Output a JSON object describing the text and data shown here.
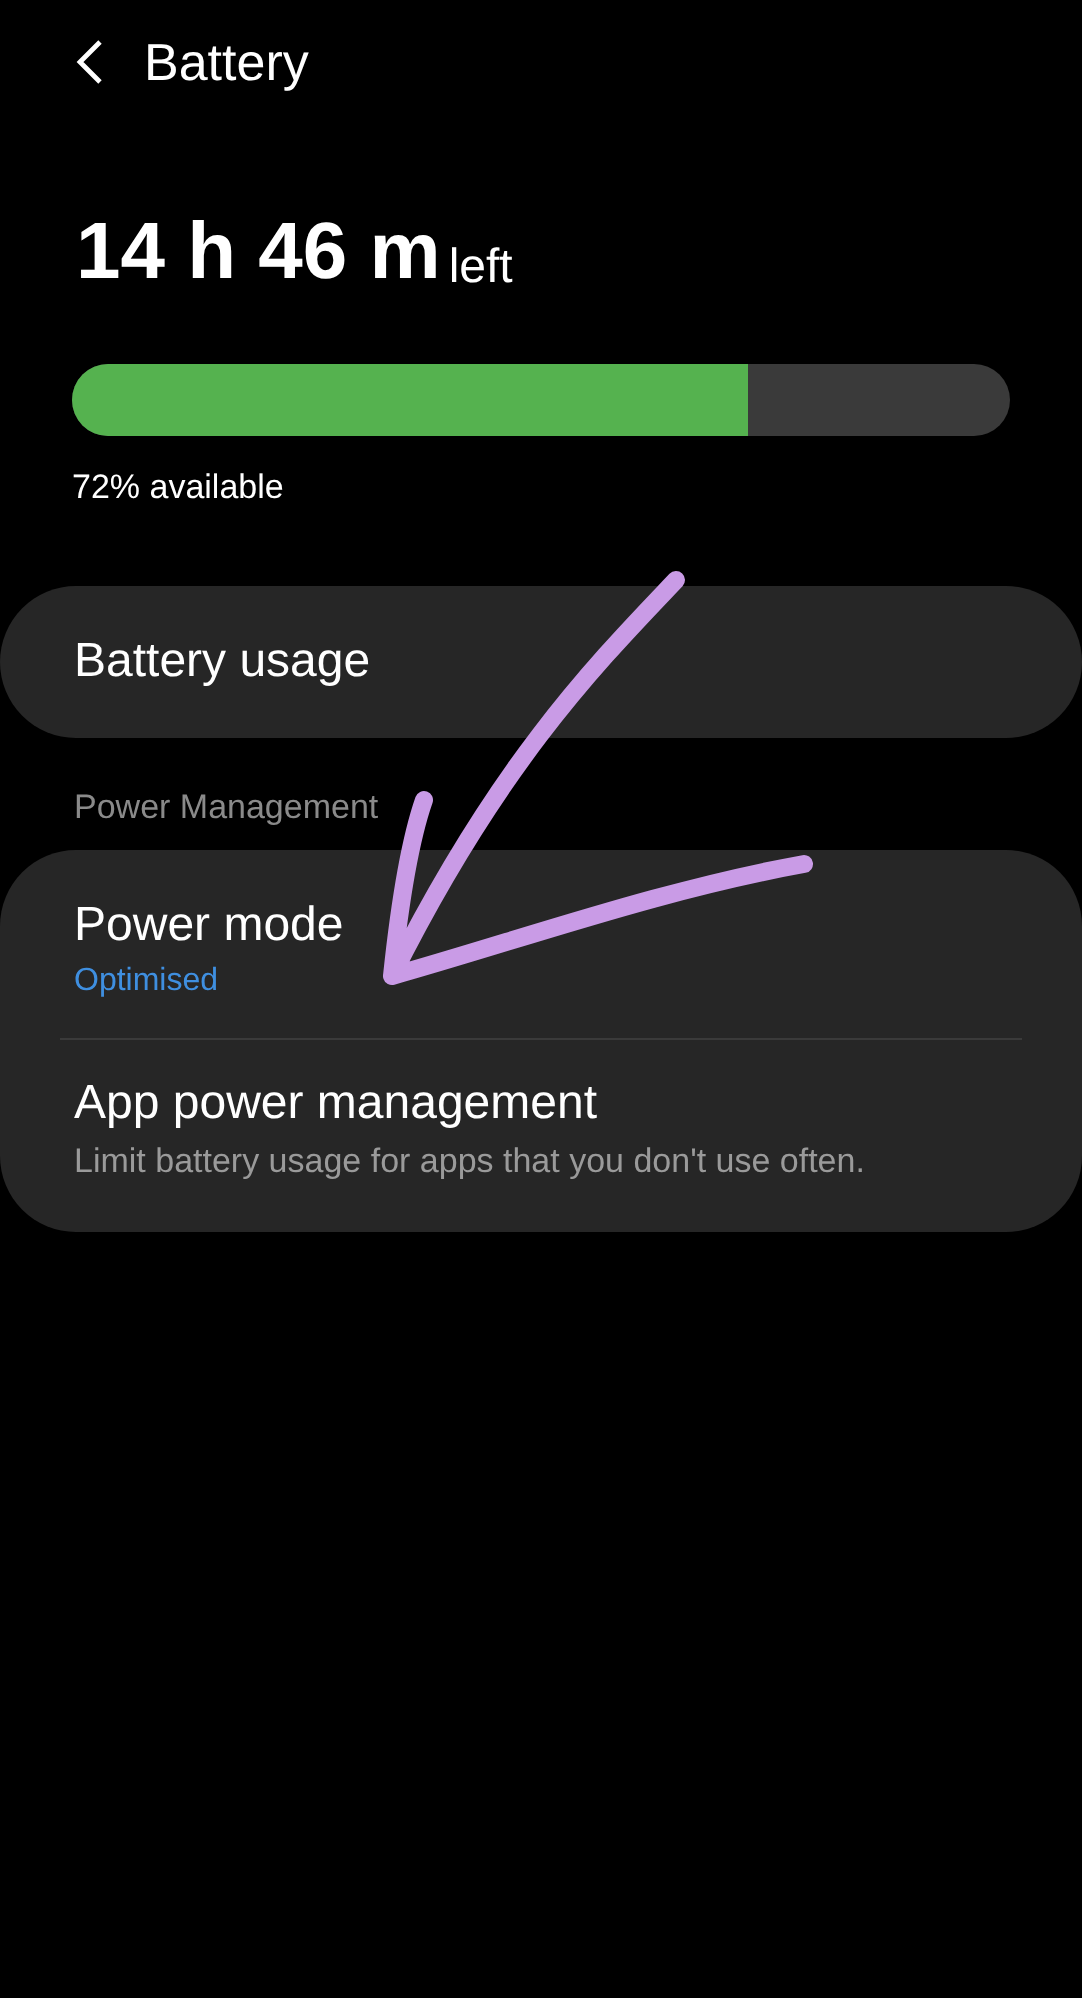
{
  "header": {
    "title": "Battery"
  },
  "battery": {
    "time": "14 h 46 m",
    "time_suffix": "left",
    "level": 0.72,
    "available": "72% available"
  },
  "top_card": {
    "label": "Battery usage"
  },
  "section": {
    "title": "Power Management"
  },
  "settings": [
    {
      "title": "Power mode",
      "subtitle": "Optimised",
      "kind": "status"
    },
    {
      "title": "App power management",
      "subtitle": "Limit battery usage for apps that you don't use often.",
      "kind": "description"
    }
  ]
}
